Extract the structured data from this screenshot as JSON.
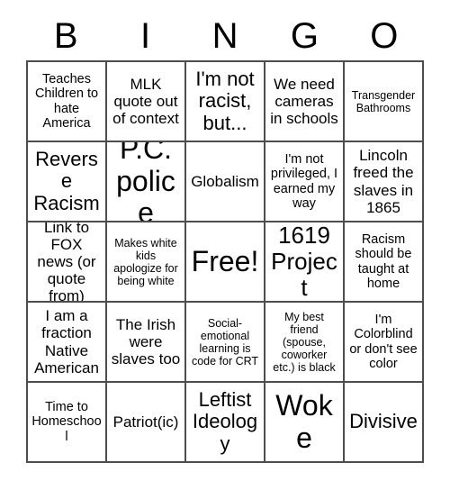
{
  "card": {
    "title": "BINGO",
    "header_letters": [
      "B",
      "I",
      "N",
      "G",
      "O"
    ],
    "grid_size": "5x5",
    "colors": {
      "background": "#ffffff",
      "text": "#000000",
      "gridline": "#4d4d4d"
    },
    "cells": [
      {
        "text": "Teaches Children to hate America",
        "size": "fs-s"
      },
      {
        "text": "MLK quote out of context",
        "size": "fs-m"
      },
      {
        "text": "I'm not racist, but...",
        "size": "fs-l"
      },
      {
        "text": "We need cameras in schools",
        "size": "fs-m"
      },
      {
        "text": "Transgender Bathrooms",
        "size": "fs-xs"
      },
      {
        "text": "Reverse Racism",
        "size": "fs-l"
      },
      {
        "text": "P.C. police",
        "size": "fs-xxl"
      },
      {
        "text": "Globalism",
        "size": "fs-m"
      },
      {
        "text": "I'm not privileged, I earned my way",
        "size": "fs-s"
      },
      {
        "text": "Lincoln freed the slaves in 1865",
        "size": "fs-m"
      },
      {
        "text": "Link to FOX news (or quote from)",
        "size": "fs-m"
      },
      {
        "text": "Makes white kids apologize for being white",
        "size": "fs-xs"
      },
      {
        "text": "Free!",
        "size": "fs-xxl"
      },
      {
        "text": "1619 Project",
        "size": "fs-xl"
      },
      {
        "text": "Racism should be taught at home",
        "size": "fs-s"
      },
      {
        "text": "I am a fraction Native American",
        "size": "fs-m"
      },
      {
        "text": "The Irish were slaves too",
        "size": "fs-m"
      },
      {
        "text": "Social-emotional learning is code for CRT",
        "size": "fs-xs"
      },
      {
        "text": "My best friend (spouse, coworker etc.) is black",
        "size": "fs-xs"
      },
      {
        "text": "I'm Colorblind or don't see color",
        "size": "fs-s"
      },
      {
        "text": "Time to Homeschool",
        "size": "fs-s"
      },
      {
        "text": "Patriot(ic)",
        "size": "fs-m"
      },
      {
        "text": "Leftist Ideology",
        "size": "fs-l"
      },
      {
        "text": "Woke",
        "size": "fs-xxl"
      },
      {
        "text": "Divisive",
        "size": "fs-l"
      }
    ]
  }
}
